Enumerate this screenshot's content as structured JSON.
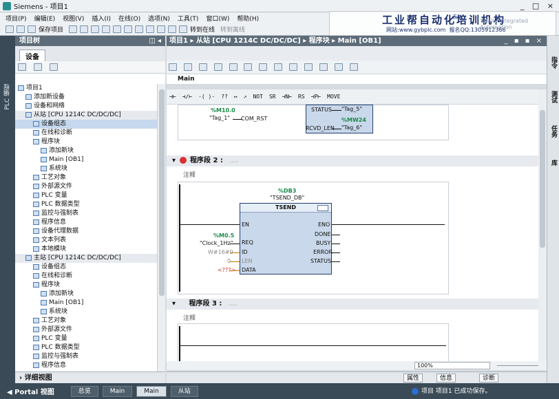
{
  "window": {
    "title": "Siemens  -  项目1",
    "controls": "_ □ ×"
  },
  "menu": [
    "项目(P)",
    "编辑(E)",
    "视图(V)",
    "插入(I)",
    "在线(O)",
    "选项(N)",
    "工具(T)",
    "窗口(W)",
    "帮助(H)"
  ],
  "toolbar": {
    "save_project": "保存项目",
    "go_online": "转到在线",
    "go_offline": "转到离线"
  },
  "banner": {
    "title": "工业帮自动化培训机构",
    "website": "网站:www.gybplc.com",
    "qq": "报名QQ:1305912366",
    "subtitle": "Totally Integrated Automation",
    "tip": "表格"
  },
  "left_panel": {
    "title": "项目树",
    "side_label": "PLC 编程",
    "device_tab": "设备",
    "detail_view": "详细视图",
    "tree": [
      {
        "label": "项目1",
        "level": 0
      },
      {
        "label": "添加新设备",
        "level": 1
      },
      {
        "label": "设备和网络",
        "level": 1
      },
      {
        "label": "从站 [CPU 1214C DC/DC/DC]",
        "level": 1,
        "hl": true
      },
      {
        "label": "设备组态",
        "level": 2,
        "sel": true
      },
      {
        "label": "在线和诊断",
        "level": 2
      },
      {
        "label": "程序块",
        "level": 2
      },
      {
        "label": "添加新块",
        "level": 3
      },
      {
        "label": "Main [OB1]",
        "level": 3
      },
      {
        "label": "系统块",
        "level": 3
      },
      {
        "label": "工艺对象",
        "level": 2
      },
      {
        "label": "外部源文件",
        "level": 2
      },
      {
        "label": "PLC 变量",
        "level": 2
      },
      {
        "label": "PLC 数据类型",
        "level": 2
      },
      {
        "label": "监控与强制表",
        "level": 2
      },
      {
        "label": "程序信息",
        "level": 2
      },
      {
        "label": "设备代理数据",
        "level": 2
      },
      {
        "label": "文本列表",
        "level": 2
      },
      {
        "label": "本地模块",
        "level": 2
      },
      {
        "label": "主站 [CPU 1214C DC/DC/DC]",
        "level": 1,
        "hl": true
      },
      {
        "label": "设备组态",
        "level": 2
      },
      {
        "label": "在线和诊断",
        "level": 2
      },
      {
        "label": "程序块",
        "level": 2
      },
      {
        "label": "添加新块",
        "level": 3
      },
      {
        "label": "Main [OB1]",
        "level": 3
      },
      {
        "label": "系统块",
        "level": 3
      },
      {
        "label": "工艺对象",
        "level": 2
      },
      {
        "label": "外部源文件",
        "level": 2
      },
      {
        "label": "PLC 变量",
        "level": 2
      },
      {
        "label": "PLC 数据类型",
        "level": 2
      },
      {
        "label": "监控与强制表",
        "level": 2
      },
      {
        "label": "程序信息",
        "level": 2
      }
    ]
  },
  "editor": {
    "breadcrumb": "项目1 ▸ 从站 [CPU 1214C DC/DC/DC] ▸ 程序块 ▸ Main [OB1]",
    "controls": "_ ▪ ▪ ×",
    "block_name": "Main",
    "ladder_buttons": [
      "⊣⊢",
      "⊣/⊢",
      "-( )-",
      "??",
      "↦",
      "↗",
      "NOT",
      "SR",
      "⊣N⊢",
      "RS",
      "⊣P⊢",
      "MOVE"
    ],
    "net1": {
      "in1_addr": "%M10.0",
      "in1_tag": "\"Tag_1\"",
      "in1_pin": "COM_RST",
      "status_pin": "STATUS",
      "status_tag": "\"Tag_5\"",
      "out_addr": "%MW24",
      "rcvd_pin": "RCVD_LEN",
      "rcvd_tag": "\"Tag_6\""
    },
    "net2": {
      "title": "程序段 2 :",
      "dots": "....",
      "comment": "注释",
      "db_addr": "%DB3",
      "db_name": "\"TSEND_DB\"",
      "block_title": "TSEND",
      "in_pins": [
        "EN",
        "REQ",
        "ID",
        "LEN",
        "DATA"
      ],
      "in_vals": [
        "",
        "\"Clock_1Hz\"",
        "W#16#0",
        "0",
        "<???>"
      ],
      "req_addr": "%M0.5",
      "out_pins": [
        "ENO",
        "DONE",
        "BUSY",
        "ERROR",
        "STATUS"
      ]
    },
    "net3": {
      "title": "程序段 3 :",
      "dots": "....",
      "comment": "注释"
    },
    "zoom": "100%"
  },
  "inspector": {
    "props": "属性",
    "info": "信息",
    "diag": "诊断"
  },
  "right_strip": [
    "指令",
    "测试",
    "任务",
    "库"
  ],
  "statusbar": {
    "portal": "◀  Portal 视图",
    "tabs": [
      "总览",
      "Main",
      "Main",
      "从站"
    ],
    "message": "项目 项目1 已成功保存。"
  }
}
